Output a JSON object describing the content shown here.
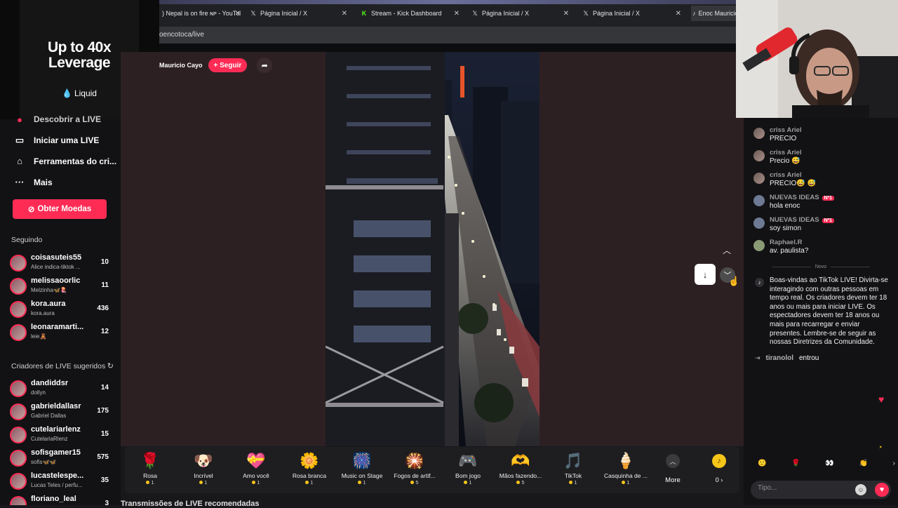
{
  "ad": {
    "title": "Up to 40x Leverage",
    "brand": "Liquid"
  },
  "browser": {
    "tabs": [
      {
        "label": ") Nepal is on fire ɴᴘ - YouTube",
        "icon": "youtube-icon"
      },
      {
        "label": "Página Inicial / X",
        "icon": "x-logo-icon"
      },
      {
        "label": "Stream - Kick Dashboard",
        "icon": "kick-logo-icon"
      },
      {
        "label": "Página Inicial / X",
        "icon": "x-logo-icon"
      },
      {
        "label": "Página Inicial / X",
        "icon": "x-logo-icon"
      },
      {
        "label": "Enoc Mauricio",
        "icon": "tiktok-icon"
      }
    ],
    "url": "oencotoca/live"
  },
  "sidebar": {
    "partial_top": "Descobrir a LIVE",
    "menu": [
      {
        "label": "Iniciar uma LIVE",
        "icon": "camera-icon"
      },
      {
        "label": "Ferramentas do cri...",
        "icon": "home-tools-icon"
      },
      {
        "label": "Mais",
        "icon": "ellipsis-icon"
      }
    ],
    "coins_button": "Obter Moedas",
    "following_title": "Seguindo",
    "following": [
      {
        "name": "coisasuteis55",
        "sub": "Alice indica-tiktok ...",
        "count": "10"
      },
      {
        "name": "melissaoorlic",
        "sub": "Melzinha🦋🪼",
        "count": "11"
      },
      {
        "name": "kora.aura",
        "sub": "kora.aura",
        "count": "436"
      },
      {
        "name": "leonaramarti...",
        "sub": "leie🧸",
        "count": "12"
      }
    ],
    "suggested_title": "Criadores de LIVE sugeridos",
    "suggested": [
      {
        "name": "dandiddsr",
        "sub": "dollyn",
        "count": "14"
      },
      {
        "name": "gabrieldallasr",
        "sub": "Gabriel Dallas",
        "count": "175"
      },
      {
        "name": "cutelariarlenz",
        "sub": "CutelariaRlenz",
        "count": "15"
      },
      {
        "name": "sofisgamer15",
        "sub": "sofis🦋🦋",
        "count": "575"
      },
      {
        "name": "lucastelespe...",
        "sub": "Lucas Teles / perfu...",
        "count": "35"
      },
      {
        "name": "floriano_leal",
        "sub": "",
        "count": "3"
      }
    ],
    "bottom_caption": "Transmissões de LIVE recomendadas"
  },
  "live": {
    "host_name": "Mauricio Cayo",
    "follow_label": "+ Seguir"
  },
  "gifts": [
    {
      "name": "Rosa",
      "price": "1",
      "icon": "🌹"
    },
    {
      "name": "Incrível",
      "price": "1",
      "icon": "🐶"
    },
    {
      "name": "Amo você",
      "price": "1",
      "icon": "💝"
    },
    {
      "name": "Rosa branca",
      "price": "1",
      "icon": "🌼"
    },
    {
      "name": "Music on Stage",
      "price": "1",
      "icon": "🎆"
    },
    {
      "name": "Fogos de artif...",
      "price": "5",
      "icon": "🎇"
    },
    {
      "name": "Bom jogo",
      "price": "1",
      "icon": "🎮"
    },
    {
      "name": "Mãos fazendo...",
      "price": "5",
      "icon": "🫶"
    },
    {
      "name": "TikTok",
      "price": "1",
      "icon": "🎵"
    },
    {
      "name": "Casquinha de ...",
      "price": "1",
      "icon": "🍦"
    }
  ],
  "gift_more_label": "More",
  "wallet_value": "0 ›",
  "chat": {
    "messages": [
      {
        "user": "criss Ariel",
        "text": "PRECIO",
        "badge": ""
      },
      {
        "user": "criss Ariel",
        "text": "Precio 😅",
        "badge": ""
      },
      {
        "user": "criss Ariel",
        "text": "PRECIO😅 😅",
        "badge": ""
      },
      {
        "user": "NUEVAS IDEAS",
        "text": "hola enoc",
        "badge": "Nº1"
      },
      {
        "user": "NUEVAS IDEAS",
        "text": "soy simon",
        "badge": "Nº1"
      },
      {
        "user": "Raphael.R",
        "text": "av. paulista?",
        "badge": ""
      }
    ],
    "new_label": "Novo",
    "welcome": "Boas-vindas ao TikTok LIVE! Divirta-se interagindo com outras pessoas em tempo real. Os criadores devem ter 18 anos ou mais para iniciar LIVE. Os espectadores devem ter 18 anos ou mais para recarregar e enviar presentes. Lembre-se de seguir as nossas Diretrizes da Comunidade.",
    "joined_user": "tiranolol",
    "joined_text": "entrou",
    "input_placeholder": "Tipo..."
  },
  "colors": {
    "accent": "#fe2c55",
    "coin": "#f5c518",
    "stage_bg": "#2d2023"
  }
}
